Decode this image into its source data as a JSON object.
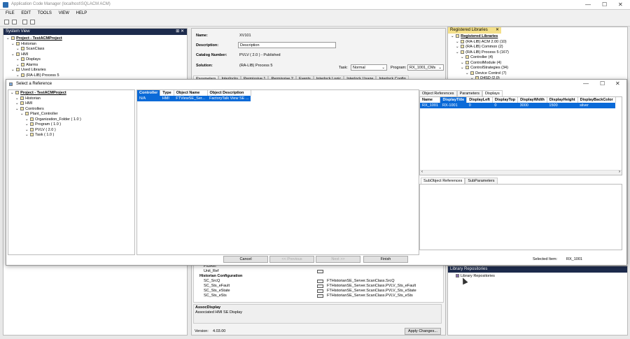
{
  "window": {
    "title": "Application Code Manager (localhost\\SQLACM ACM)",
    "minimize": "—",
    "maximize": "☐",
    "close": "✕"
  },
  "menu": [
    "FILE",
    "EDIT",
    "TOOLS",
    "VIEW",
    "HELP"
  ],
  "system_view": {
    "title": "System View",
    "pin": "⊞ ✕",
    "tree": [
      {
        "label": "Project - TestACMProject",
        "depth": 0,
        "bold": true
      },
      {
        "label": "Historian",
        "depth": 1
      },
      {
        "label": "ScanClass",
        "depth": 2
      },
      {
        "label": "HMI",
        "depth": 1
      },
      {
        "label": "Displays",
        "depth": 2
      },
      {
        "label": "Alarms",
        "depth": 2
      },
      {
        "label": "Used Libraries",
        "depth": 1
      },
      {
        "label": "(RA-LIB) Process 5",
        "depth": 2
      }
    ]
  },
  "properties": {
    "name_label": "Name:",
    "name_value": "XV101",
    "desc_label": "Description:",
    "desc_value": "Description",
    "catalog_label": "Catalog Number:",
    "catalog_value": "PVLV  ( 2.0 )  -  Published",
    "solution_label": "Solution:",
    "solution_value": "(RA-LIB) Process 5",
    "task_label": "Task:",
    "task_value": "Normal",
    "program_label": "Program:",
    "program_value": "RX_1001_CMs",
    "tabs": [
      "Parameters",
      "Interlocks",
      "Permissive 1",
      "Permissive 2",
      "Events",
      "Interlock Logic",
      "Interlock Usage",
      "Interlock Config"
    ]
  },
  "registered_libraries": {
    "title": "Registered Libraries",
    "tree": [
      {
        "label": "Registered Libraries",
        "depth": 0,
        "bold": true
      },
      {
        "label": "(RA-LIB) ACM 2.00 (10)",
        "depth": 1
      },
      {
        "label": "(RA-LIB) Common (2)",
        "depth": 1
      },
      {
        "label": "(RA-LIB) Process 5 (167)",
        "depth": 1
      },
      {
        "label": "Controller (4)",
        "depth": 2
      },
      {
        "label": "ControlModule (4)",
        "depth": 2
      },
      {
        "label": "ControlStrategies (34)",
        "depth": 2
      },
      {
        "label": "Device Control (7)",
        "depth": 3
      },
      {
        "label": "D4SD (2.0)",
        "depth": 4
      }
    ]
  },
  "dialog": {
    "title": "Select a Reference",
    "tree": [
      {
        "label": "Project - TestACMProject",
        "depth": 0,
        "bold": true
      },
      {
        "label": "Historian",
        "depth": 1
      },
      {
        "label": "HMI",
        "depth": 1
      },
      {
        "label": "Controllers",
        "depth": 1
      },
      {
        "label": "Plant_Controller",
        "depth": 2
      },
      {
        "label": "Organization_Folder  ( 1.0 )",
        "depth": 3
      },
      {
        "label": "Program  ( 1.0 )",
        "depth": 3
      },
      {
        "label": "PVLV  ( 2.0 )",
        "depth": 3
      },
      {
        "label": "Task  ( 1.0 )",
        "depth": 3
      }
    ],
    "ref_grid": {
      "headers": [
        "Controller",
        "Type",
        "Object Name",
        "Object Description"
      ],
      "rows": [
        [
          "N/A",
          "HMI",
          "FTViewSE_Ser...",
          "FactoryTalk View SE ..."
        ]
      ]
    },
    "right_tabs": [
      "Object References",
      "Parameters",
      "Displays"
    ],
    "displays_grid": {
      "headers": [
        "Name",
        "DisplayTitle",
        "DisplayLeft",
        "DisplayTop",
        "DisplayWidth",
        "DisplayHeight",
        "DisplayBackColor"
      ],
      "rows": [
        [
          "RX_1001",
          "RX-1001",
          "0",
          "0",
          "3000",
          "1500",
          "silver"
        ]
      ]
    },
    "lower_tabs": [
      "SubObject References",
      "SubParameters"
    ],
    "buttons": {
      "cancel": "Cancel",
      "previous": "<< Previous",
      "next": "Next >>",
      "finish": "Finish"
    },
    "selected_label": "Selected Item:",
    "selected_value": "RX_1001"
  },
  "param_rows": [
    {
      "label": "PIDRef",
      "value": "",
      "button": false,
      "group": false
    },
    {
      "label": "Unit_Ref",
      "value": "",
      "button": true,
      "group": false
    },
    {
      "label": "Historian Configuration",
      "value": "",
      "button": false,
      "group": true
    },
    {
      "label": "SC_SrcQ",
      "value": "FTHistorianSE_Server.ScanClass.SrcQ",
      "button": true,
      "group": false
    },
    {
      "label": "SC_Sts_eFault",
      "value": "FTHistorianSE_Server.ScanClass.PVLV_Sts_eFault",
      "button": true,
      "group": false
    },
    {
      "label": "SC_Sts_eState",
      "value": "FTHistorianSE_Server.ScanClass.PVLV_Sts_eState",
      "button": true,
      "group": false
    },
    {
      "label": "SC_Sts_eSts",
      "value": "FTHistorianSE_Server.ScanClass.PVLV_Sts_eSts",
      "button": true,
      "group": false
    }
  ],
  "assoc": {
    "title": "AssocDisplay",
    "desc": "Associated HMI SE Display"
  },
  "version": {
    "label": "Version:",
    "value": "4.03.00"
  },
  "apply_button": "Apply Changes...",
  "library_repos": {
    "title": "Library Repositories",
    "item": "Library Repositories"
  },
  "colors": {
    "accent": "#0a6ad8",
    "dark_header": "#1d2b4c"
  }
}
